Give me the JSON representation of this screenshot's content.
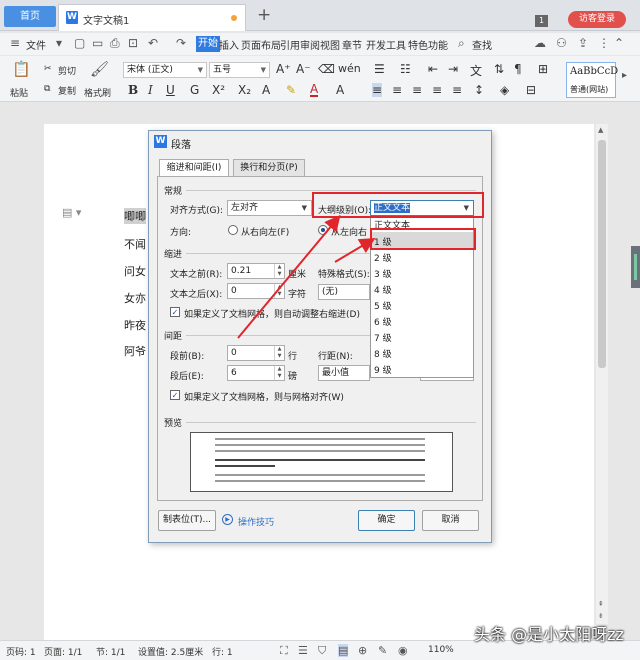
{
  "tabs": {
    "home": "首页",
    "document": "文字文稿1",
    "window_count": "1",
    "visitor_login": "访客登录"
  },
  "menu": {
    "file": "文件",
    "items": [
      "开始",
      "插入",
      "页面布局",
      "引用",
      "审阅",
      "视图",
      "章节",
      "开发工具",
      "特色功能"
    ],
    "active": "开始",
    "search": "查找"
  },
  "ribbon": {
    "paste": "粘贴",
    "cut": "剪切",
    "copy": "复制",
    "format_painter": "格式刷",
    "font_name": "宋体 (正文)",
    "font_size": "五号",
    "bold": "B",
    "italic": "I",
    "underline": "U",
    "style_sample": "AaBbCcD",
    "style_name": "普通(网站)"
  },
  "document": {
    "lines": [
      "唧唧",
      "不闻",
      "问女",
      "女亦",
      "昨夜",
      "阿爷"
    ]
  },
  "dialog": {
    "title": "段落",
    "tab_indent": "缩进和间距(I)",
    "tab_break": "换行和分页(P)",
    "section_general": "常规",
    "align_label": "对齐方式(G):",
    "align_value": "左对齐",
    "outline_label": "大纲级别(O):",
    "outline_value": "正文文本",
    "direction_label": "方向:",
    "rtl": "从右向左(F)",
    "ltr": "从左向右",
    "section_indent": "缩进",
    "before_text_label": "文本之前(R):",
    "before_text_value": "0.21",
    "before_text_unit": "厘米",
    "special_label": "特殊格式(S):",
    "after_text_label": "文本之后(X):",
    "after_text_value": "0",
    "after_text_unit": "字符",
    "special_value": "(无)",
    "auto_indent": "如果定义了文档网格，则自动调整右缩进(D)",
    "section_spacing": "间距",
    "before_label": "段前(B):",
    "before_value": "0",
    "before_unit": "行",
    "line_spacing_label": "行距(N):",
    "after_label": "段后(E):",
    "after_value": "6",
    "after_unit": "磅",
    "line_spacing_value": "最小值",
    "snap_grid": "如果定义了文档网格，则与网格对齐(W)",
    "section_preview": "预览",
    "tabs_button": "制表位(T)...",
    "tips": "操作技巧",
    "ok": "确定",
    "cancel": "取消"
  },
  "outline_dropdown": {
    "items": [
      "正文文本",
      "1 级",
      "2 级",
      "3 级",
      "4 级",
      "5 级",
      "6 级",
      "7 级",
      "8 级",
      "9 级"
    ],
    "highlighted": "1 级"
  },
  "status": {
    "page_num": "页码: 1",
    "page": "页面: 1/1",
    "section": "节: 1/1",
    "setting": "设置值: 2.5厘米",
    "row": "行: 1",
    "zoom": "110%"
  },
  "watermark": "头条 @是小太阳呀zz",
  "colors": {
    "accent": "#2f7be0",
    "annotation": "#e0262b",
    "visitor": "#e2504c"
  }
}
